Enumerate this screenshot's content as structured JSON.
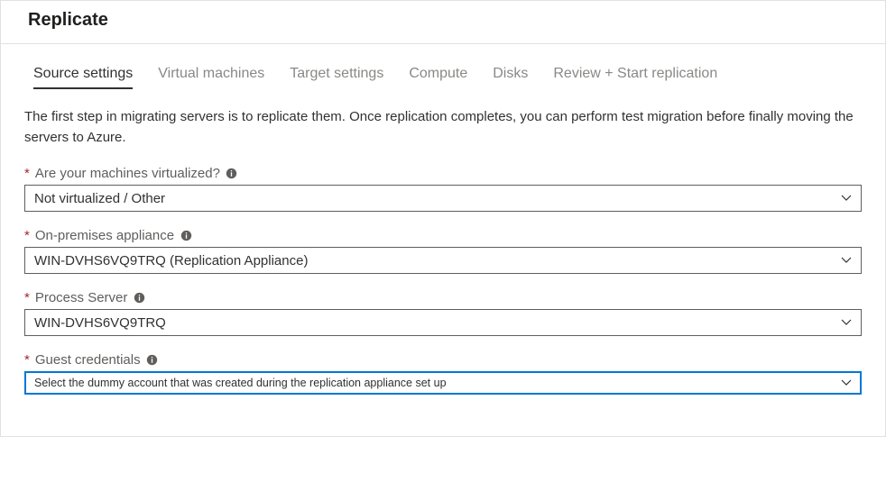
{
  "header": {
    "title": "Replicate"
  },
  "tabs": [
    {
      "label": "Source settings",
      "active": true
    },
    {
      "label": "Virtual machines",
      "active": false
    },
    {
      "label": "Target settings",
      "active": false
    },
    {
      "label": "Compute",
      "active": false
    },
    {
      "label": "Disks",
      "active": false
    },
    {
      "label": "Review + Start replication",
      "active": false
    }
  ],
  "intro": "The first step in migrating servers is to replicate them. Once replication completes, you can perform test migration before finally moving the servers to Azure.",
  "fields": {
    "virtualized": {
      "label": "Are your machines virtualized?",
      "value": "Not virtualized / Other"
    },
    "appliance": {
      "label": "On-premises appliance",
      "value": "WIN-DVHS6VQ9TRQ (Replication Appliance)"
    },
    "process_server": {
      "label": "Process Server",
      "value": "WIN-DVHS6VQ9TRQ"
    },
    "guest_credentials": {
      "label": "Guest credentials",
      "value": "Select the dummy account that was created during the replication appliance set up"
    }
  }
}
